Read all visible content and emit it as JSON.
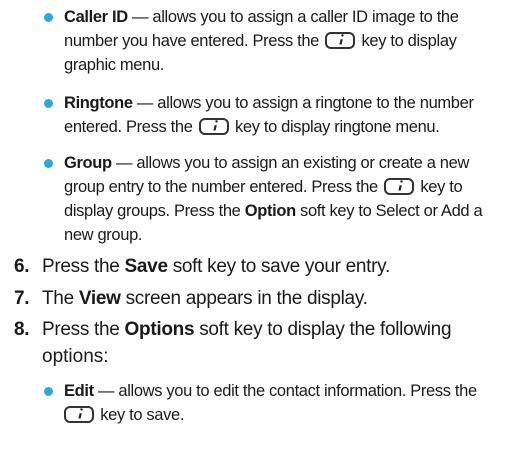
{
  "bullets_top": [
    {
      "term": "Caller ID",
      "lines": [
        [
          " — allows you to assign a caller ID image to the"
        ],
        [
          "number you have entered. Press the ",
          {
            "icon": "info-key-icon"
          },
          " key to display"
        ],
        [
          "graphic menu."
        ]
      ]
    },
    {
      "term": "Ringtone",
      "lines": [
        [
          " — allows you to assign a ringtone to the number"
        ],
        [
          "entered. Press the ",
          {
            "icon": "info-key-icon"
          },
          " key to display ringtone menu."
        ]
      ]
    },
    {
      "term": "Group",
      "lines": [
        [
          " — allows you to assign an existing or create a new"
        ],
        [
          "group entry to the number entered. Press the ",
          {
            "icon": "info-key-icon"
          },
          " key to"
        ],
        [
          "display groups. Press the ",
          {
            "bold": "Option"
          },
          " soft key to Select or Add a"
        ],
        [
          "new group."
        ]
      ]
    }
  ],
  "steps": [
    {
      "number": "6.",
      "parts": [
        "Press the ",
        {
          "bold": "Save"
        },
        " soft key to save your entry."
      ]
    },
    {
      "number": "7.",
      "parts": [
        "The ",
        {
          "bold": "View"
        },
        " screen appears in the display."
      ]
    },
    {
      "number": "8.",
      "parts": [
        "Press the ",
        {
          "bold": "Options"
        },
        " soft key to display the following"
      ],
      "continuation": "options:"
    }
  ],
  "bullets_bottom": [
    {
      "term": "Edit",
      "lines": [
        [
          " — allows you to edit the contact information. Press the"
        ],
        [
          {
            "icon": "info-key-icon"
          },
          " key to save."
        ]
      ]
    }
  ],
  "colors": {
    "bullet": "#2aa6e0",
    "text": "#1a1a1a"
  }
}
